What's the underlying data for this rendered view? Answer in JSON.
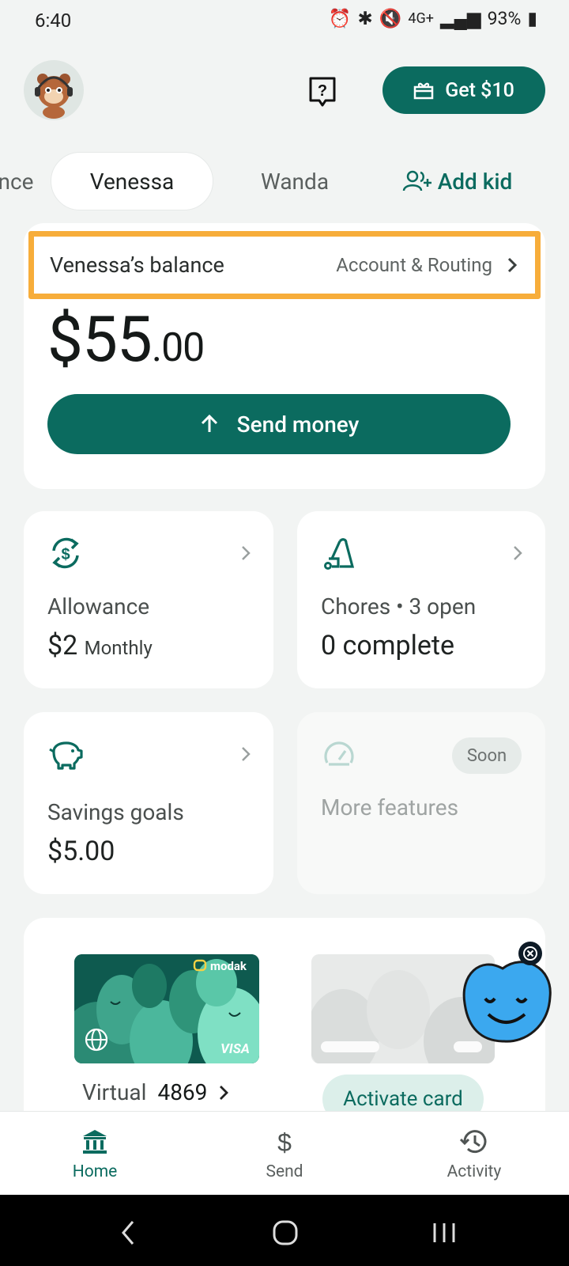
{
  "status": {
    "time": "6:40",
    "battery": "93%",
    "network_mini": "4G+"
  },
  "header": {
    "get_button_label": "Get $10"
  },
  "kid_tabs": {
    "partial": "nce",
    "active": "Venessa",
    "other": "Wanda",
    "add": "Add kid"
  },
  "balance": {
    "label": "Venessa’s balance",
    "routing_link": "Account & Routing",
    "amount_whole": "$55",
    "amount_cents": ".00",
    "send_label": "Send money"
  },
  "tiles": {
    "allowance": {
      "title": "Allowance",
      "value": "$2",
      "period": "Monthly"
    },
    "chores": {
      "title": "Chores • 3 open",
      "value": "0 complete"
    },
    "savings": {
      "title": "Savings goals",
      "value": "$5.00"
    },
    "more": {
      "title": "More features",
      "badge": "Soon"
    }
  },
  "cards": {
    "virtual_label": "Virtual",
    "virtual_last4": "4869",
    "activate_label": "Activate card",
    "brand": "modak",
    "network": "VISA"
  },
  "bottom_nav": {
    "home": "Home",
    "send": "Send",
    "activity": "Activity"
  },
  "colors": {
    "primary": "#0b6b5f",
    "highlight": "#f7ad3a",
    "bubble": "#3ba8ef"
  }
}
